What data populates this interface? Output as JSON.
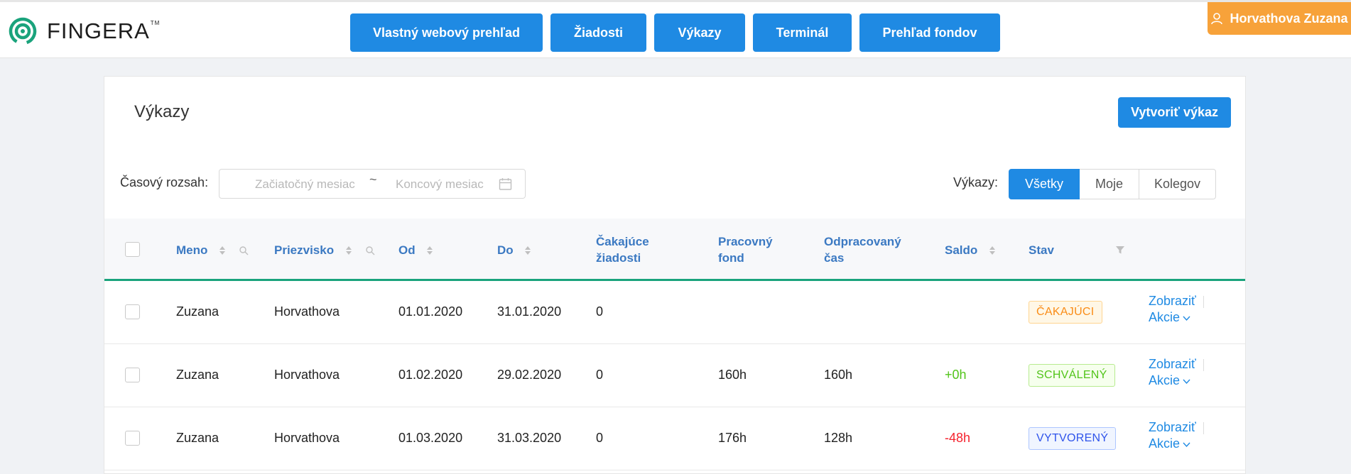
{
  "header": {
    "logo_text": "FINGERA",
    "logo_tm": "TM",
    "nav": [
      {
        "label": "Vlastný webový prehľad"
      },
      {
        "label": "Žiadosti"
      },
      {
        "label": "Výkazy"
      },
      {
        "label": "Terminál"
      },
      {
        "label": "Prehľad fondov"
      }
    ],
    "user_name": "Horvathova Zuzana",
    "user_icon": "user-icon"
  },
  "page": {
    "title": "Výkazy",
    "create_button": "Vytvoriť výkaz"
  },
  "filters": {
    "range_label": "Časový rozsah",
    "range_start_placeholder": "Začiatočný mesiac",
    "range_separator": "~",
    "range_end_placeholder": "Koncový mesiac",
    "calendar_icon": "calendar-icon",
    "scope_label": "Výkazy",
    "scope_options": [
      "Všetky",
      "Moje",
      "Kolegov"
    ],
    "scope_selected": "Všetky"
  },
  "table": {
    "columns": {
      "name": "Meno",
      "surname": "Priezvisko",
      "from": "Od",
      "to": "Do",
      "pending_line1": "Čakajúce",
      "pending_line2": "žiadosti",
      "fund_line1": "Pracovný",
      "fund_line2": "fond",
      "worked_line1": "Odpracovaný",
      "worked_line2": "čas",
      "saldo": "Saldo",
      "status": "Stav"
    },
    "rows": [
      {
        "name": "Zuzana",
        "surname": "Horvathova",
        "from": "01.01.2020",
        "to": "31.01.2020",
        "pending": "0",
        "fund": "",
        "worked": "",
        "saldo": "",
        "status": "ČAKAJÚCI",
        "status_kind": "waiting",
        "action_view": "Zobraziť",
        "action_more": "Akcie"
      },
      {
        "name": "Zuzana",
        "surname": "Horvathova",
        "from": "01.02.2020",
        "to": "29.02.2020",
        "pending": "0",
        "fund": "160h",
        "worked": "160h",
        "saldo": "+0h",
        "status": "SCHVÁLENÝ",
        "status_kind": "approved",
        "action_view": "Zobraziť",
        "action_more": "Akcie"
      },
      {
        "name": "Zuzana",
        "surname": "Horvathova",
        "from": "01.03.2020",
        "to": "31.03.2020",
        "pending": "0",
        "fund": "176h",
        "worked": "128h",
        "saldo": "-48h",
        "status": "VYTVORENÝ",
        "status_kind": "created",
        "action_view": "Zobraziť",
        "action_more": "Akcie"
      }
    ]
  },
  "colors": {
    "primary": "#1f8ae3",
    "user_button": "#f7a23a",
    "header_underline": "#1aa37c",
    "header_text": "#3b79c2",
    "saldo_positive": "#52c41a",
    "saldo_negative": "#f5222d",
    "logo_teal": "#1aa37c"
  }
}
